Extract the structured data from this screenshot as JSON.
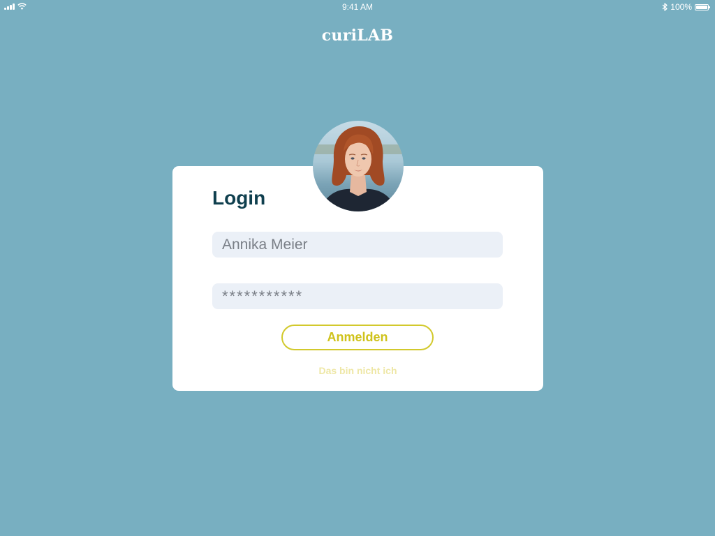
{
  "status_bar": {
    "time": "9:41 AM",
    "battery": "100%",
    "battery_level": 1.0
  },
  "app": {
    "title": "curiLAB"
  },
  "login": {
    "heading": "Login",
    "username_value": "Annika Meier",
    "password_value": "***********",
    "submit_label": "Anmelden",
    "not_me_label": "Das bin nicht ich"
  },
  "icons": {
    "signal": "signal-icon",
    "wifi": "wifi-icon",
    "bluetooth": "bluetooth-icon",
    "battery": "battery-icon"
  },
  "colors": {
    "background": "#78afc1",
    "card": "#ffffff",
    "heading": "#0f3f4e",
    "input_background": "#ebf0f7",
    "accent": "#d2c92c",
    "secondary_link": "#eee7a6"
  }
}
